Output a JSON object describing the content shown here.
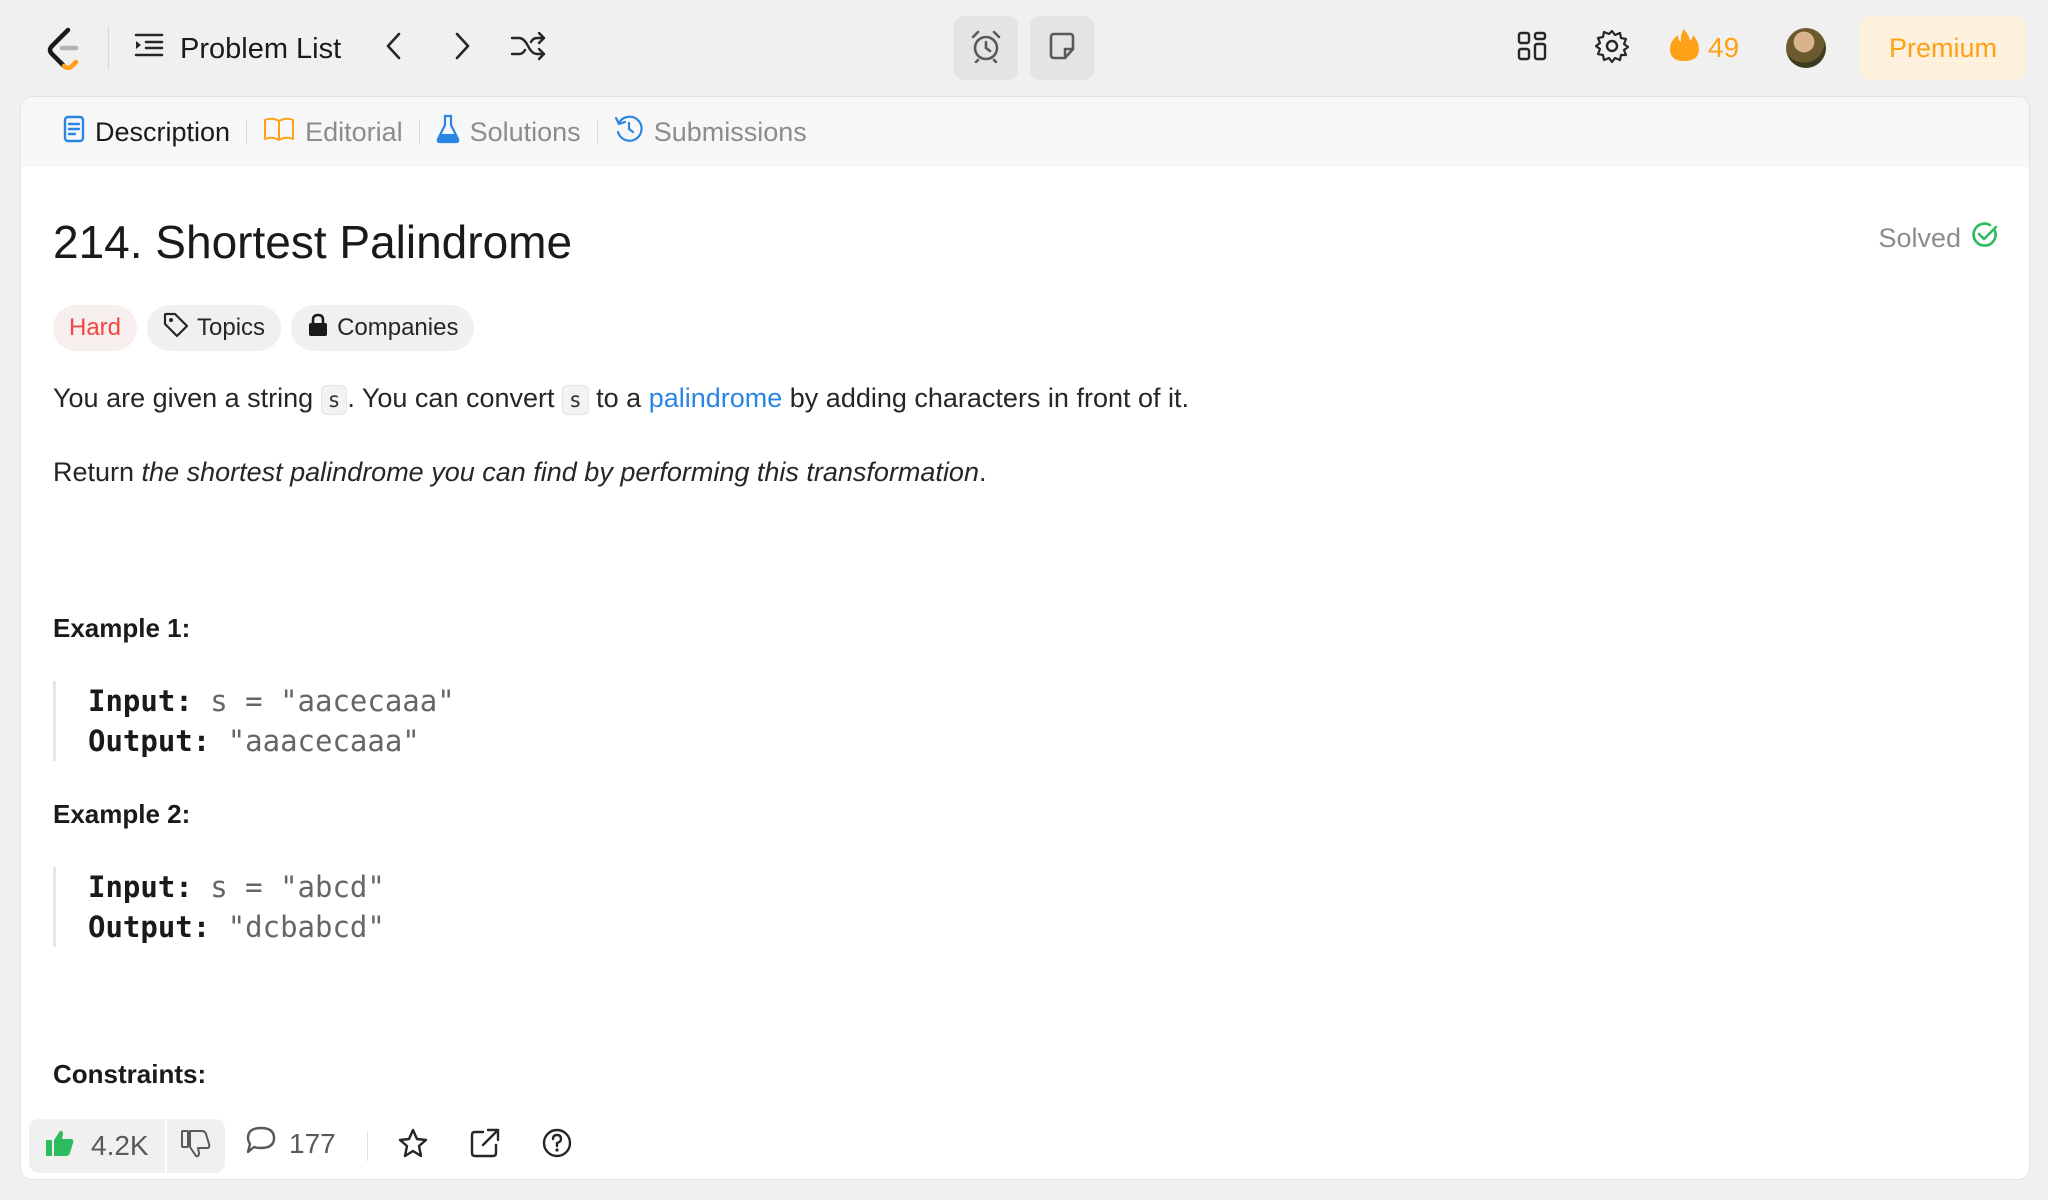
{
  "nav": {
    "problem_list_label": "Problem List",
    "streak_count": "49",
    "premium_label": "Premium"
  },
  "tabs": [
    {
      "label": "Description",
      "icon": "description-icon"
    },
    {
      "label": "Editorial",
      "icon": "book-icon"
    },
    {
      "label": "Solutions",
      "icon": "flask-icon"
    },
    {
      "label": "Submissions",
      "icon": "history-icon"
    }
  ],
  "problem": {
    "title": "214. Shortest Palindrome",
    "status": "Solved",
    "difficulty": "Hard",
    "topics_label": "Topics",
    "companies_label": "Companies",
    "desc1_a": "You are given a string ",
    "desc1_code1": "s",
    "desc1_b": ". You can convert ",
    "desc1_code2": "s",
    "desc1_c": " to a ",
    "desc1_link": "palindrome",
    "desc1_d": " by adding characters in front of it.",
    "desc2_a": "Return ",
    "desc2_italic": "the shortest palindrome you can find by performing this transformation",
    "desc2_b": ".",
    "examples": [
      {
        "heading": "Example 1:",
        "input_label": "Input:",
        "input": "s = \"aacecaaa\"",
        "output_label": "Output:",
        "output": "\"aaacecaaa\""
      },
      {
        "heading": "Example 2:",
        "input_label": "Input:",
        "input": "s = \"abcd\"",
        "output_label": "Output:",
        "output": "\"dcbabcd\""
      }
    ],
    "constraints_heading": "Constraints:"
  },
  "footer": {
    "likes": "4.2K",
    "comments": "177"
  },
  "colors": {
    "accent": "#ffa116",
    "hard": "#ef4743",
    "link": "#2a85e4",
    "solved": "#2cbb5d",
    "like": "#2cbb5d"
  }
}
